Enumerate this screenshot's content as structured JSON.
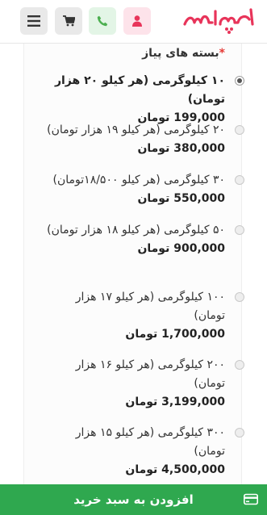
{
  "header": {
    "logo_text": "ماچین",
    "icons": [
      "menu-icon",
      "cart-icon",
      "phone-icon",
      "user-icon"
    ],
    "colors": {
      "brand": "#e8345a",
      "phone_green": "#4caf50",
      "user_pink": "#e8345a"
    }
  },
  "form": {
    "required_mark": "*",
    "title": "بسته های پیاز",
    "options": [
      {
        "label": "۱۰ کیلوگرمی (هر کیلو ۲۰ هزار تومان)",
        "price": "199,000 تومان",
        "selected": true
      },
      {
        "label": "۲۰ کیلوگرمی (هر کیلو ۱۹ هزار تومان)",
        "price": "380,000 تومان",
        "selected": false
      },
      {
        "label": "۳۰ کیلوگرمی (هر کیلو ۱۸/۵۰۰تومان)",
        "price": "550,000 تومان",
        "selected": false
      },
      {
        "label": "۵۰ کیلوگرمی (هر کیلو ۱۸ هزار تومان)",
        "price": "900,000 تومان",
        "selected": false
      },
      {
        "label": "۱۰۰ کیلوگرمی (هر کیلو ۱۷ هزار تومان)",
        "price": "1,700,000 تومان",
        "selected": false
      },
      {
        "label": "۲۰۰ کیلوگرمی (هر کیلو ۱۶ هزار تومان)",
        "price": "3,199,000 تومان",
        "selected": false
      },
      {
        "label": "۳۰۰ کیلوگرمی (هر کیلو ۱۵ هزار تومان)",
        "price": "4,500,000 تومان",
        "selected": false
      }
    ]
  },
  "footer": {
    "add_to_cart_label": "افزودن به سبد خرید",
    "icon": "wallet-icon",
    "color": "#2fa84f"
  }
}
